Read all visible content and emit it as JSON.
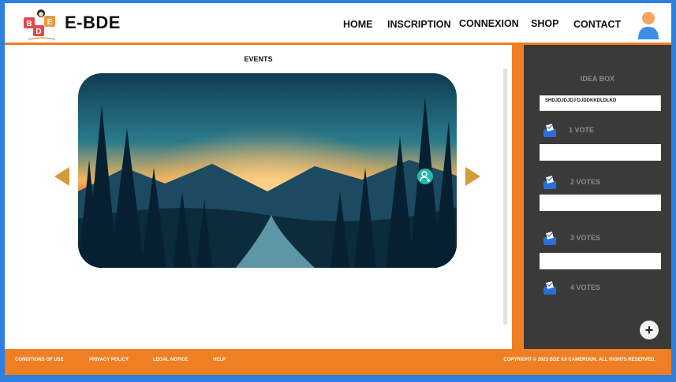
{
  "brand": {
    "name": "E-BDE",
    "logo_icon": "bde-logo-icon"
  },
  "nav": {
    "home": "HOME",
    "inscription": "INSCRIPTION",
    "connexion": "CONNEXION",
    "shop": "SHOP",
    "contact": "CONTACT"
  },
  "main": {
    "title": "EVENTS",
    "slide_image": "forest-sunset-lake-image",
    "prev_icon": "triangle-left-icon",
    "next_icon": "triangle-right-icon"
  },
  "idea_box": {
    "title": "IDEA BOX",
    "input_value": "SHDJDJDJDJ DJDDKKDLDLKD",
    "votes": [
      {
        "label": "1 VOTE"
      },
      {
        "label": "2 VOTES"
      },
      {
        "label": "3 VOTES"
      },
      {
        "label": "4 VOTES"
      }
    ],
    "add_icon": "plus-icon"
  },
  "footer": {
    "links": [
      "CONDITIONS OF USE",
      "PRIVACY POLICY",
      "LEGAL NOTICE",
      "HELP"
    ],
    "copyright": "COPYRIGHT © 2023 BDE IUI CAMEROUN. ALL RIGHTS RESERVED."
  },
  "colors": {
    "frame_blue": "#2f7fe0",
    "accent_orange": "#ef7f22",
    "panel_dark": "#3a3a3a",
    "arrow_gold": "#d59a3a",
    "teal": "#23b7b0"
  }
}
